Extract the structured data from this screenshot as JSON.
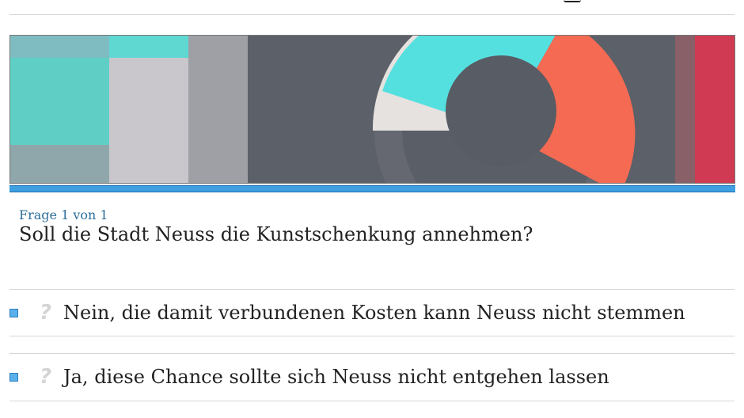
{
  "poll": {
    "counter": "Frage 1 von 1",
    "question": "Soll die Stadt Neuss die Kunstschenkung annehmen?",
    "answers": [
      {
        "label": "Nein, die damit verbundenen Kosten kann Neuss nicht stemmen",
        "icon": "question-icon"
      },
      {
        "label": "Ja, diese Chance sollte sich Neuss nicht entgehen lassen",
        "icon": "question-icon"
      }
    ]
  },
  "colors": {
    "accent": "#3f9fe0",
    "counter_text": "#2d6f9b",
    "checkbox_fill": "#5ab0ea"
  }
}
